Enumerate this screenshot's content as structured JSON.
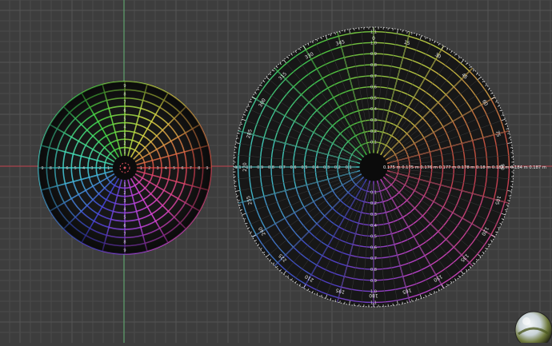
{
  "viewport": {
    "background": "#3d3d3d",
    "grid_color": "#4a4a4a",
    "grid_major_color": "#555555",
    "axis_x_color": "#a8434b",
    "axis_y_color": "#5fa26f"
  },
  "small_wheel": {
    "rings": 9,
    "spokes": 24,
    "ring_labels": [
      "1",
      "2",
      "3",
      "4",
      "5",
      "6",
      "7",
      "8",
      "9"
    ]
  },
  "large_wheel": {
    "rings": 11,
    "spokes": 24,
    "angle_labels": [
      "0",
      "15",
      "30",
      "45",
      "60",
      "75",
      "90",
      "105",
      "120",
      "135",
      "150",
      "165",
      "180",
      "195",
      "210",
      "225",
      "240",
      "255",
      "270",
      "285",
      "300",
      "315",
      "330",
      "345"
    ],
    "ring_labels": [
      "0.1",
      "0.2",
      "0.3",
      "0.4",
      "0.5",
      "0.6",
      "0.7",
      "0.8",
      "0.9",
      "1.0",
      "1.1"
    ],
    "measure_readout": "0.175 m  0.175 m  0.176 m  0.177 m  0.178 m  0.18 m  0.182 m  0.184 m  0.187 m",
    "bezel_color": "#d8d8d8"
  },
  "hdri_preview": {
    "icon": "hdri-sphere-icon",
    "color_sky": "#dfe7ec",
    "color_ground": "#6f7a3c"
  }
}
